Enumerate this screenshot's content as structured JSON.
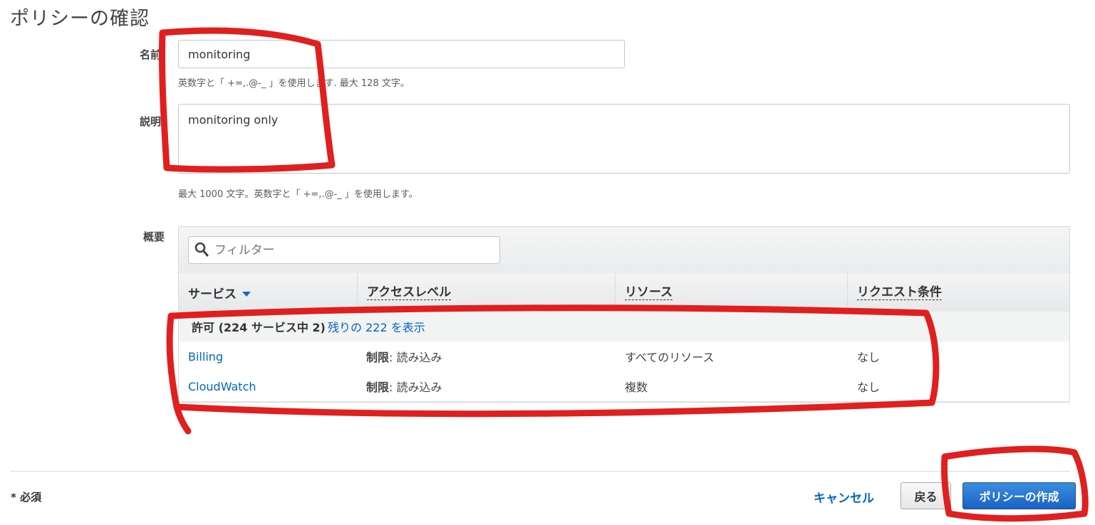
{
  "page": {
    "title": "ポリシーの確認"
  },
  "form": {
    "name_label": "名前",
    "name_value": "monitoring",
    "name_help": "英数字と「 +=,.@-_ 」を使用します. 最大 128 文字。",
    "desc_label": "説明",
    "desc_value": "monitoring only",
    "desc_help": "最大 1000 文字。英数字と「 +=,.@-_ 」を使用します。",
    "summary_label": "概要"
  },
  "summary": {
    "filter_placeholder": "フィルター",
    "columns": [
      "サービス",
      "アクセスレベル",
      "リソース",
      "リクエスト条件"
    ],
    "group_label": "許可 (224 サービス中 2)",
    "group_link": "残りの 222 を表示",
    "rows": [
      {
        "service": "Billing",
        "access_bold": "制限",
        "access_rest": ": 読み込み",
        "resource": "すべてのリソース",
        "condition": "なし"
      },
      {
        "service": "CloudWatch",
        "access_bold": "制限",
        "access_rest": ": 読み込み",
        "resource": "複数",
        "condition": "なし"
      }
    ]
  },
  "footer": {
    "required": "* 必須",
    "cancel": "キャンセル",
    "back": "戻る",
    "create": "ポリシーの作成"
  },
  "colors": {
    "link": "#0066c0",
    "primary_button": "#1a62c4",
    "annotation": "#e01f1f"
  },
  "icons": {
    "search": "search-icon",
    "sort": "sort-down-icon"
  }
}
